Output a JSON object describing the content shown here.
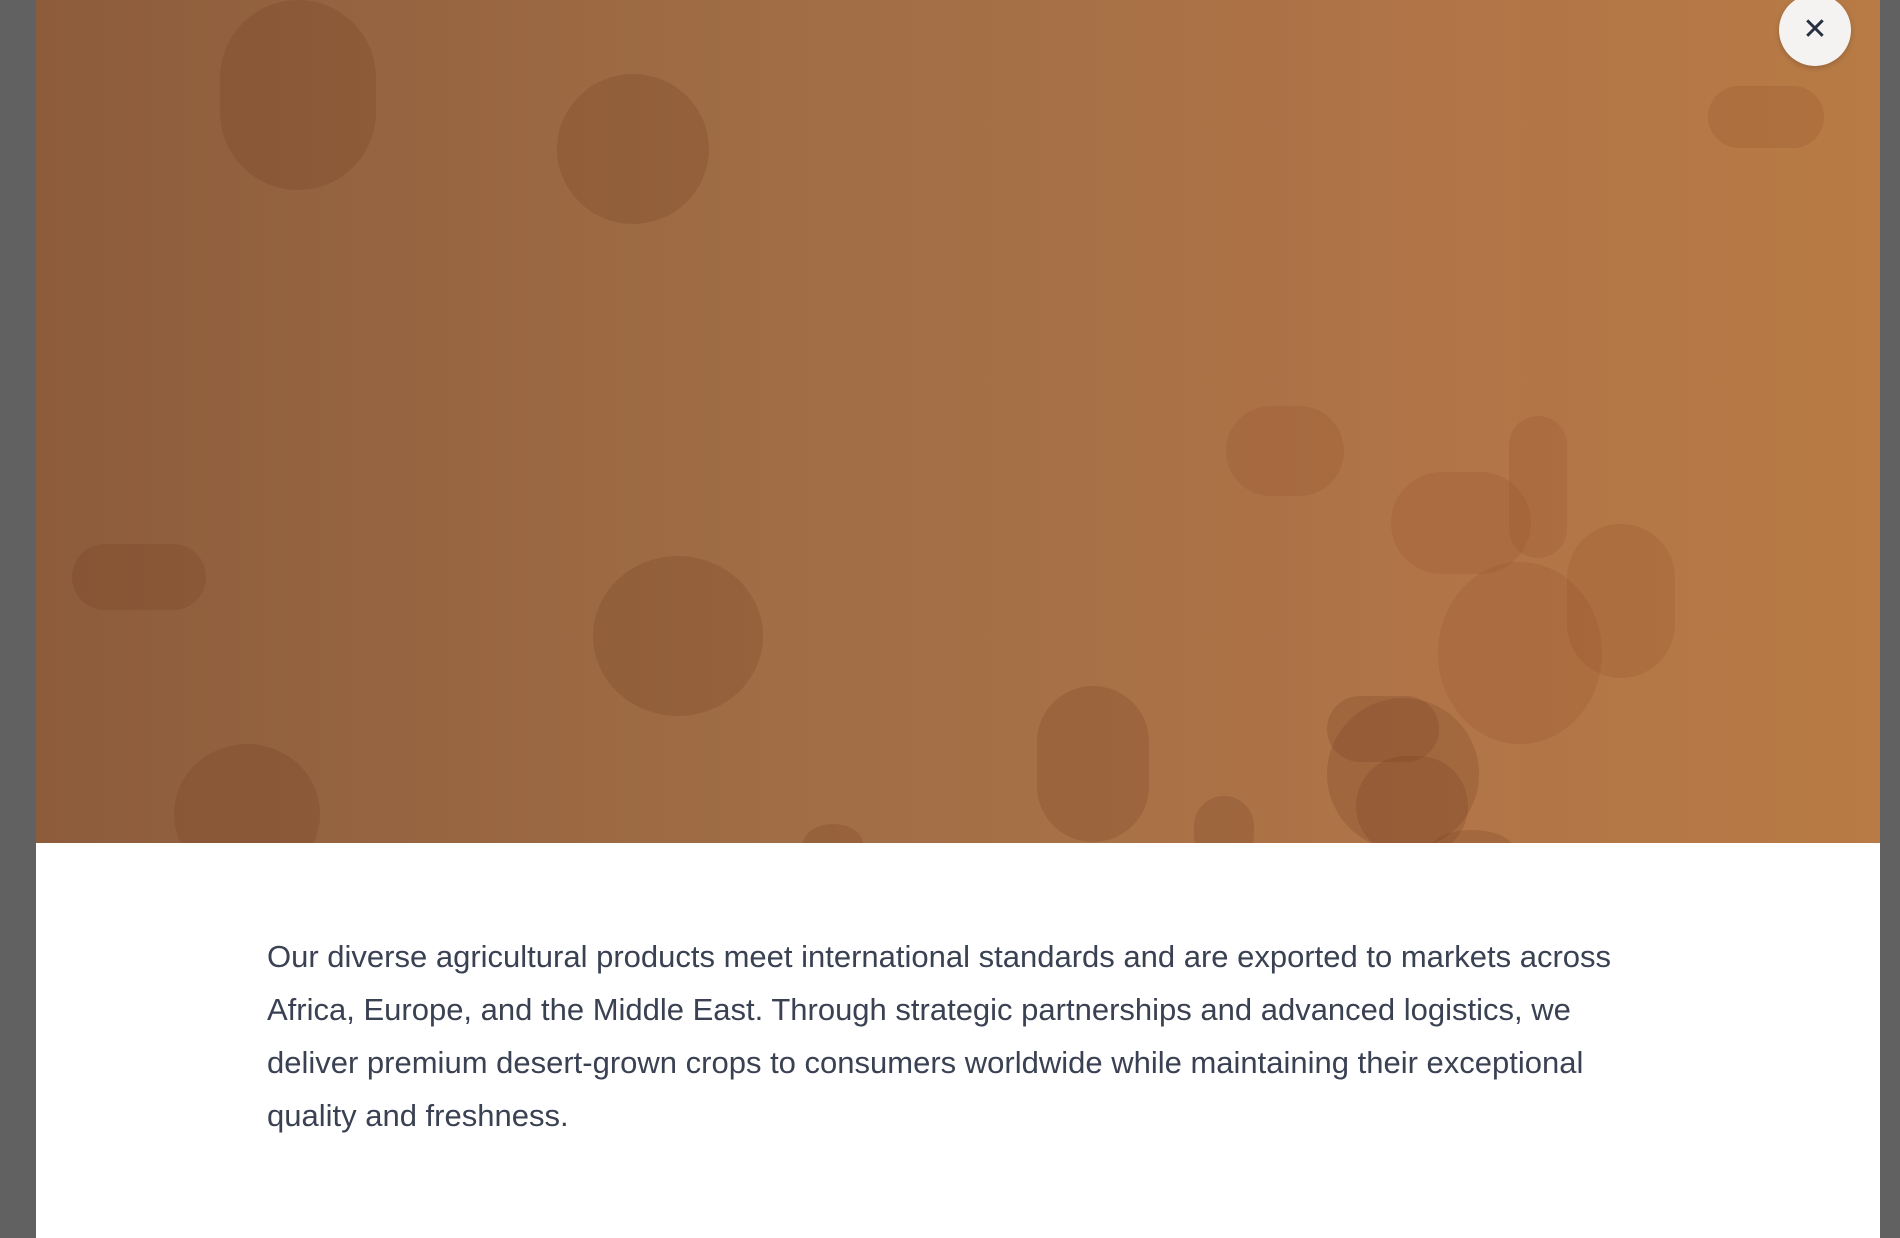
{
  "modal": {
    "close_icon": "close-icon",
    "close_glyph": "✕",
    "description": "Our diverse agricultural products meet international standards and are exported to markets across Africa, Europe, and the Middle East. Through strategic partnerships and advanced logistics, we deliver premium desert-grown crops to consumers worldwide while maintaining their exceptional quality and freshness."
  },
  "colors": {
    "hero_start": "#8d5c3b",
    "hero_end": "#b87b45",
    "text": "#3a4152",
    "overlay": "#616161"
  }
}
